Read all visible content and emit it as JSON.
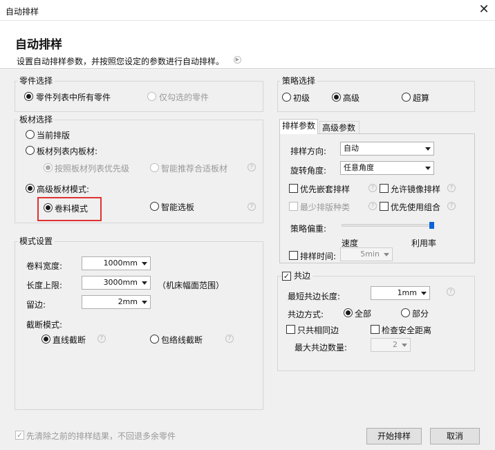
{
  "window": {
    "title": "自动排样",
    "close_icon": "close-icon"
  },
  "header": {
    "title": "自动排样",
    "subtitle": "设置自动排样参数，并按照您设定的参数进行自动排样。"
  },
  "part_selection": {
    "legend": "零件选择",
    "all_parts": "零件列表中所有零件",
    "checked_parts": "仅勾选的零件"
  },
  "sheet_selection": {
    "legend": "板材选择",
    "current_layout": "当前排版",
    "list_sheet": "板材列表内板材:",
    "by_priority": "按照板材列表优先级",
    "smart_recommend": "智能推荐合适板材",
    "advanced_mode": "高级板材模式:",
    "coil_mode": "卷料模式",
    "smart_select": "智能选板"
  },
  "mode_settings": {
    "legend": "模式设置",
    "coil_width_label": "卷料宽度:",
    "coil_width_value": "1000mm",
    "length_limit_label": "长度上限:",
    "length_limit_value": "3000mm",
    "length_limit_note": "（机床幅面范围）",
    "margin_label": "留边:",
    "margin_value": "2mm",
    "cut_mode_label": "截断模式:",
    "straight_cut": "直线截断",
    "envelope_cut": "包络线截断"
  },
  "strategy": {
    "legend": "策略选择",
    "beginner": "初级",
    "advanced": "高级",
    "super": "超算"
  },
  "tabs": {
    "params": "排样参数",
    "advanced_params": "高级参数"
  },
  "layout_params": {
    "direction_label": "排样方向:",
    "direction_value": "自动",
    "rotation_label": "旋转角度:",
    "rotation_value": "任意角度",
    "nest_first": "优先嵌套排样",
    "allow_mirror": "允许镜像排样",
    "min_types": "最少排版种类",
    "combo_first": "优先使用组合",
    "bias_label": "策略偏重:",
    "bias_left": "速度",
    "bias_right": "利用率",
    "bias_value": 1.0,
    "time_label": "排样时间:",
    "time_value": "5min"
  },
  "common_edge": {
    "legend": "共边",
    "min_length_label": "最短共边长度:",
    "min_length_value": "1mm",
    "mode_label": "共边方式:",
    "mode_all": "全部",
    "mode_partial": "部分",
    "same_only": "只共相同边",
    "check_safe": "检查安全距离",
    "max_count_label": "最大共边数量:",
    "max_count_value": "2"
  },
  "footer": {
    "clear_previous": "先清除之前的排样结果，不回退多余零件",
    "start_button": "开始排样",
    "cancel_button": "取消"
  }
}
